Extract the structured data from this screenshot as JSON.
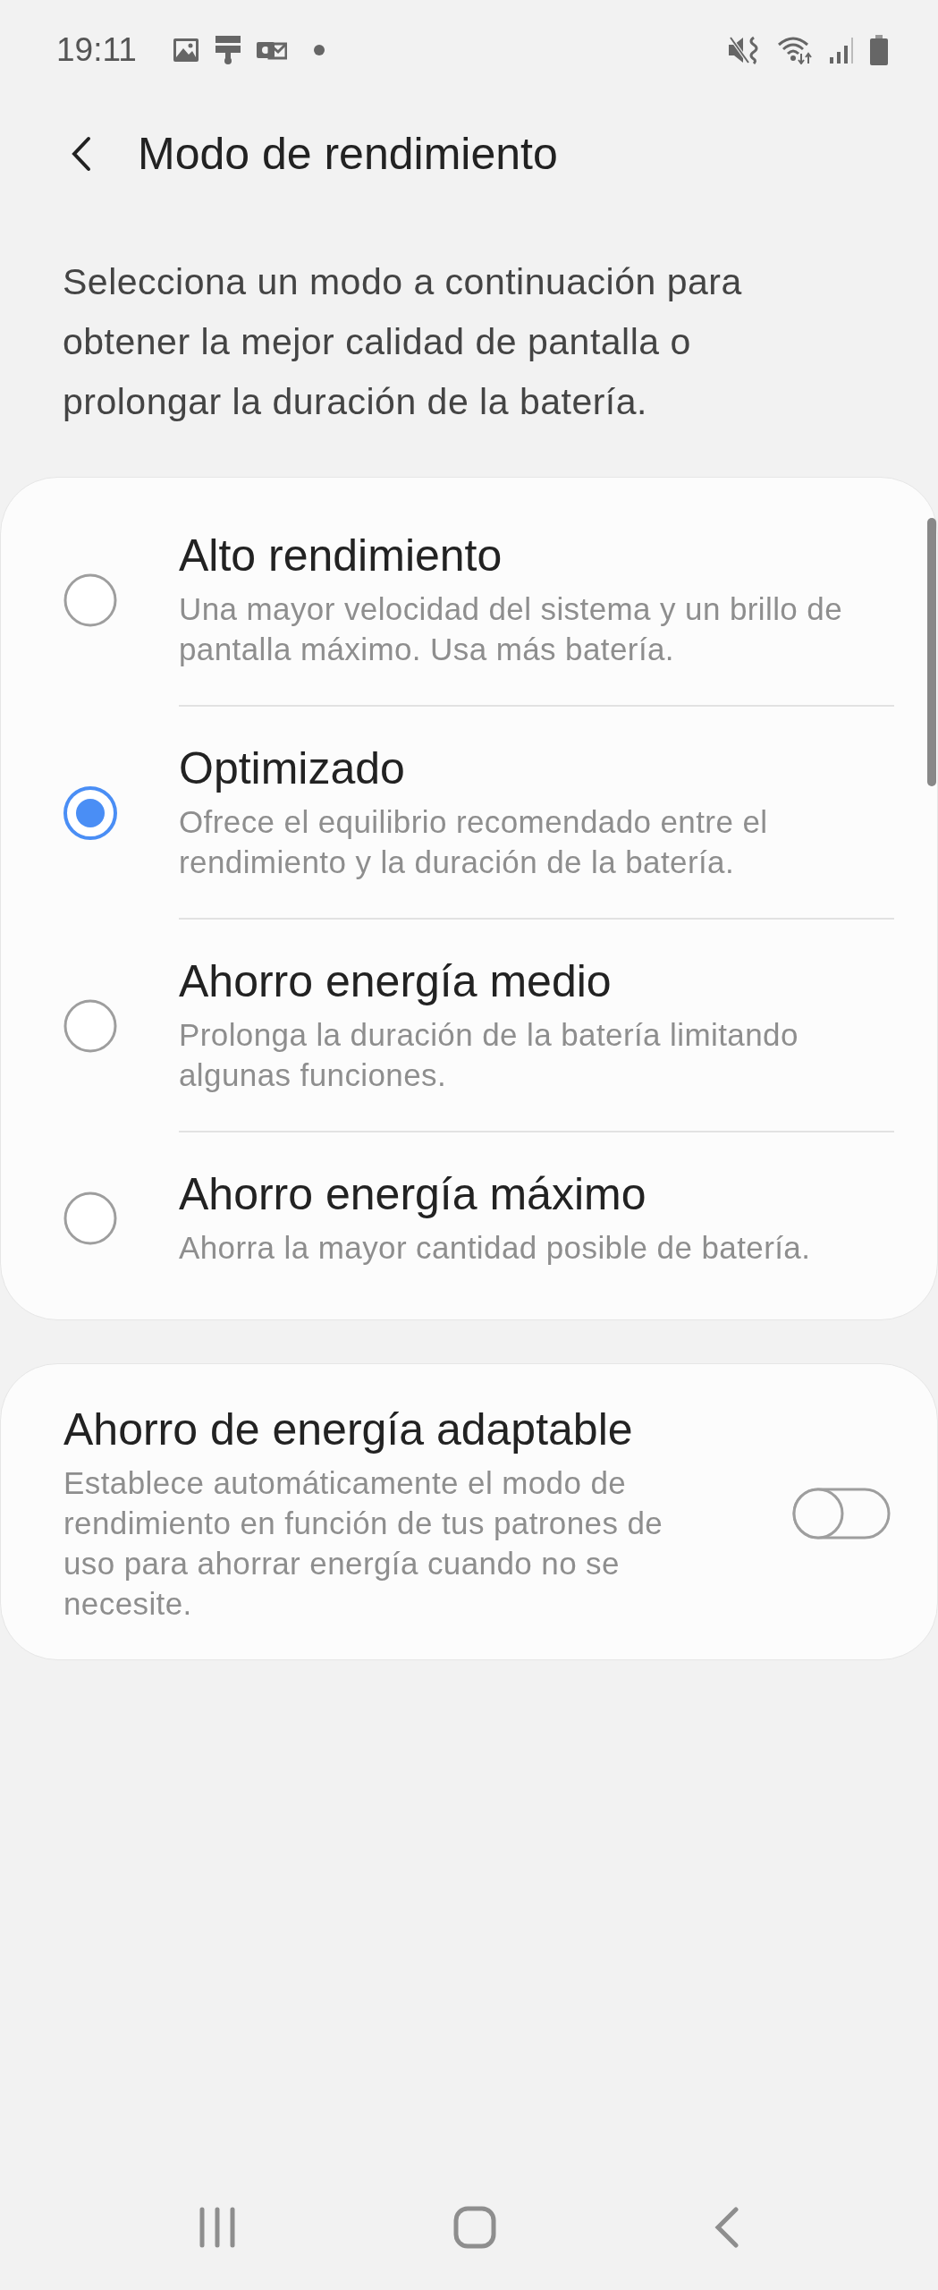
{
  "status_bar": {
    "time": "19:11"
  },
  "header": {
    "title": "Modo de rendimiento"
  },
  "description": "Selecciona un modo a continuación para obtener la mejor calidad de pantalla o prolongar la duración de la batería.",
  "modes": [
    {
      "title": "Alto rendimiento",
      "description": "Una mayor velocidad del sistema y un brillo de pantalla máximo. Usa más batería.",
      "selected": false
    },
    {
      "title": "Optimizado",
      "description": "Ofrece el equilibrio recomendado entre el rendimiento y la duración de la batería.",
      "selected": true
    },
    {
      "title": "Ahorro energía medio",
      "description": "Prolonga la duración de la batería limitando algunas funciones.",
      "selected": false
    },
    {
      "title": "Ahorro energía máximo",
      "description": "Ahorra la mayor cantidad posible de batería.",
      "selected": false
    }
  ],
  "adaptive": {
    "title": "Ahorro de energía adaptable",
    "description": "Establece automáticamente el modo de rendimiento en función de tus patrones de uso para ahorrar energía cuando no se necesite.",
    "on": false
  }
}
